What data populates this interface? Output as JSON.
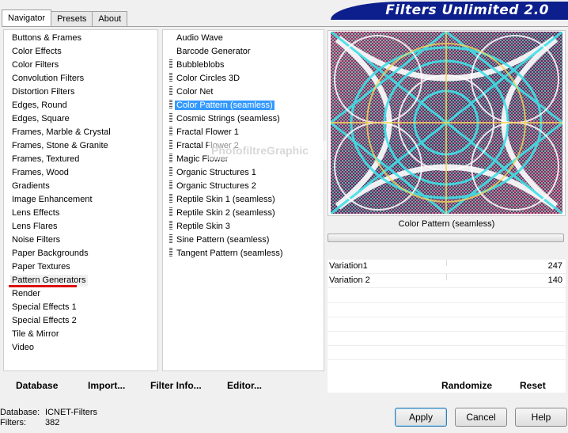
{
  "tabs": [
    "Navigator",
    "Presets",
    "About"
  ],
  "title": "Filters Unlimited 2.0",
  "categories": [
    "Buttons & Frames",
    "Color Effects",
    "Color Filters",
    "Convolution Filters",
    "Distortion Filters",
    "Edges, Round",
    "Edges, Square",
    "Frames, Marble & Crystal",
    "Frames, Stone & Granite",
    "Frames, Textured",
    "Frames, Wood",
    "Gradients",
    "Image Enhancement",
    "Lens Effects",
    "Lens Flares",
    "Noise Filters",
    "Paper Backgrounds",
    "Paper Textures",
    "Pattern Generators",
    "Render",
    "Special Effects 1",
    "Special Effects 2",
    "Tile & Mirror",
    "Video"
  ],
  "filters": [
    {
      "label": "Audio Wave",
      "grip": false
    },
    {
      "label": "Barcode Generator",
      "grip": false
    },
    {
      "label": "Bubbleblobs",
      "grip": true
    },
    {
      "label": "Color Circles 3D",
      "grip": true
    },
    {
      "label": "Color Net",
      "grip": true
    },
    {
      "label": "Color Pattern (seamless)",
      "grip": true,
      "selected": true
    },
    {
      "label": "Cosmic Strings (seamless)",
      "grip": true
    },
    {
      "label": "Fractal Flower 1",
      "grip": true
    },
    {
      "label": "Fractal Flower 2",
      "grip": true
    },
    {
      "label": "Magic Flower",
      "grip": true
    },
    {
      "label": "Organic Structures 1",
      "grip": true
    },
    {
      "label": "Organic Structures 2",
      "grip": true
    },
    {
      "label": "Reptile Skin 1 (seamless)",
      "grip": true
    },
    {
      "label": "Reptile Skin 2 (seamless)",
      "grip": true
    },
    {
      "label": "Reptile Skin 3",
      "grip": true
    },
    {
      "label": "Sine Pattern (seamless)",
      "grip": true
    },
    {
      "label": "Tangent Pattern (seamless)",
      "grip": true
    }
  ],
  "watermark": "PhotofiltreGraphic",
  "preview": {
    "caption": "Color Pattern (seamless)"
  },
  "params": [
    {
      "name": "Variation1",
      "value": "247"
    },
    {
      "name": "Variation 2",
      "value": "140"
    }
  ],
  "actions": {
    "database": "Database",
    "import": "Import...",
    "filter_info": "Filter Info...",
    "editor": "Editor...",
    "randomize": "Randomize",
    "reset": "Reset"
  },
  "status": {
    "database_label": "Database:",
    "database_value": "ICNET-Filters",
    "filters_label": "Filters:",
    "filters_value": "382"
  },
  "buttons": {
    "apply": "Apply",
    "cancel": "Cancel",
    "help": "Help"
  },
  "colors": {
    "title_bar": "#0d1f8c",
    "selection": "#3399ff",
    "highlight_underline": "#e00000"
  }
}
